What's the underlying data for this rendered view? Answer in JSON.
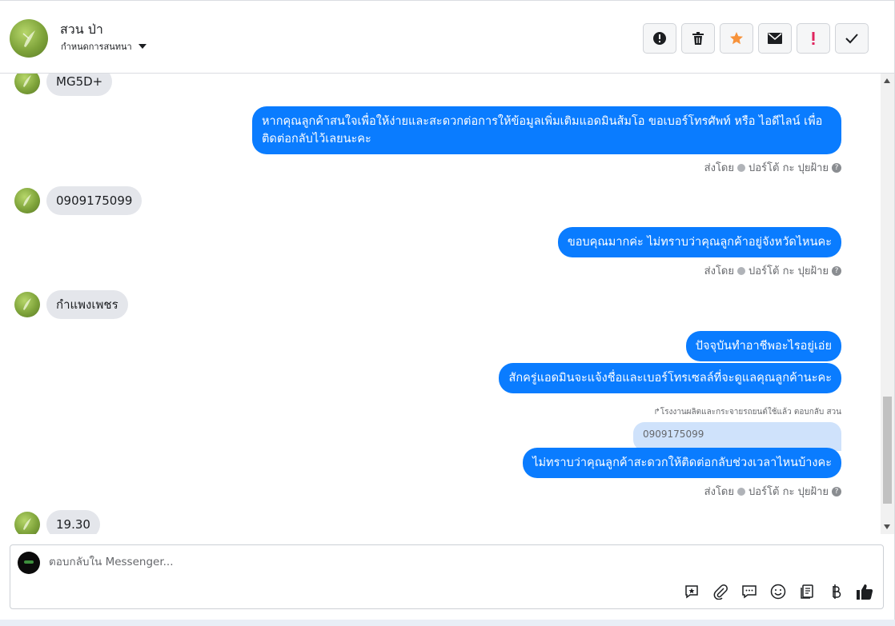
{
  "header": {
    "contact_name": "สวน ป่า",
    "assign_label": "กำหนดการสนทนา",
    "actions": [
      "alert-circle-icon",
      "trash-icon",
      "star-icon",
      "envelope-icon",
      "exclamation-icon",
      "check-icon"
    ]
  },
  "messages": [
    {
      "dir": "in",
      "text": "MG5D+"
    },
    {
      "dir": "out",
      "text": "หากคุณลูกค้าสนใจเพื่อให้ง่ายและสะดวกต่อการให้ข้อมูลเพิ่มเติมแอดมินส้มโอ ขอเบอร์โทรศัพท์ หรือ ไอดีไลน์ เพื่อติดต่อกลับไว้เลยนะคะ"
    },
    {
      "dir": "in",
      "text": "0909175099"
    },
    {
      "dir": "out",
      "text": "ขอบคุณมากค่ะ ไม่ทราบว่าคุณลูกค้าอยู่จังหวัดไหนคะ"
    },
    {
      "dir": "in",
      "text": "กำแพงเพชร"
    },
    {
      "dir": "out",
      "text": "ปัจจุบันทำอาชีพอะไรอยู่เอ่ย"
    },
    {
      "dir": "out",
      "text": "สักครู่แอดมินจะแจ้งชื่อและเบอร์โทรเซลล์ที่จะดูแลคุณลูกค้านะคะ"
    },
    {
      "dir": "out",
      "text": "ไม่ทราบว่าคุณลูกค้าสะดวกให้ติดต่อกลับช่วงเวลาไหนบ้างคะ"
    },
    {
      "dir": "in",
      "text": "19.30"
    }
  ],
  "sent_by": {
    "prefix": "ส่งโดย",
    "agent": "ปอร์โต้ กะ ปุยฝ้าย"
  },
  "reply_note": "โรงงานผลิตและกระจายรถยนต์ใช้แล้ว ตอบกลับ สวน",
  "quoted_text": "0909175099",
  "composer": {
    "placeholder": "ตอบกลับใน Messenger...",
    "tools": [
      "saved-reply-icon",
      "paperclip-icon",
      "chat-bubble-icon",
      "emoji-icon",
      "catalog-icon",
      "baht-icon",
      "thumbs-up-icon"
    ]
  },
  "colors": {
    "outgoing_bubble": "#0a7cff",
    "incoming_bubble": "#e4e6eb",
    "star": "#f7923a",
    "exclamation": "#e0245e"
  }
}
